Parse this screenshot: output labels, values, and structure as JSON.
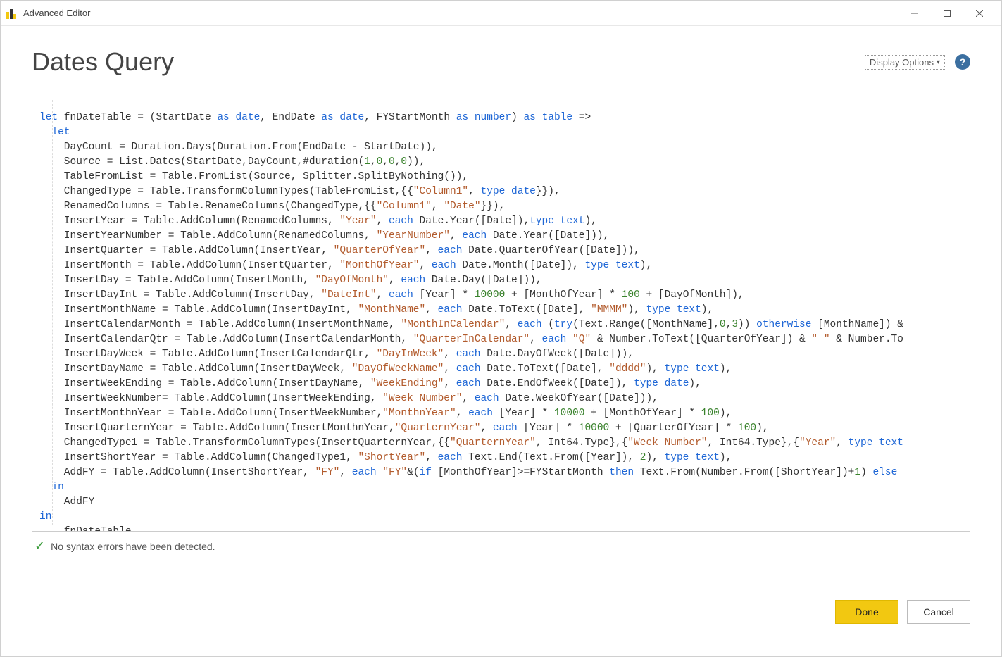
{
  "window": {
    "title": "Advanced Editor"
  },
  "header": {
    "query_title": "Dates Query",
    "display_options_label": "Display Options",
    "help_tooltip": "Help"
  },
  "code": {
    "tokens": [
      [
        [
          "kw",
          "let"
        ],
        [
          "",
          " fnDateTable = (StartDate "
        ],
        [
          "kw",
          "as"
        ],
        [
          "",
          " "
        ],
        [
          "tp",
          "date"
        ],
        [
          "",
          ", EndDate "
        ],
        [
          "kw",
          "as"
        ],
        [
          "",
          " "
        ],
        [
          "tp",
          "date"
        ],
        [
          "",
          ", FYStartMonth "
        ],
        [
          "kw",
          "as"
        ],
        [
          "",
          " "
        ],
        [
          "tp",
          "number"
        ],
        [
          "",
          ") "
        ],
        [
          "kw",
          "as"
        ],
        [
          "",
          " "
        ],
        [
          "tp",
          "table"
        ],
        [
          "",
          " =>"
        ]
      ],
      [
        [
          "",
          "  "
        ],
        [
          "kw",
          "let"
        ]
      ],
      [
        [
          "",
          "    DayCount = Duration.Days(Duration.From(EndDate - StartDate)),"
        ]
      ],
      [
        [
          "",
          "    Source = List.Dates(StartDate,DayCount,#duration("
        ],
        [
          "num",
          "1"
        ],
        [
          "",
          ","
        ],
        [
          "num",
          "0"
        ],
        [
          "",
          ","
        ],
        [
          "num",
          "0"
        ],
        [
          "",
          ","
        ],
        [
          "num",
          "0"
        ],
        [
          "",
          ")),"
        ]
      ],
      [
        [
          "",
          "    TableFromList = Table.FromList(Source, Splitter.SplitByNothing()),"
        ]
      ],
      [
        [
          "",
          "    ChangedType = Table.TransformColumnTypes(TableFromList,{{"
        ],
        [
          "str",
          "\"Column1\""
        ],
        [
          "",
          ", "
        ],
        [
          "kw",
          "type"
        ],
        [
          "",
          " "
        ],
        [
          "tp",
          "date"
        ],
        [
          "",
          "}}),"
        ]
      ],
      [
        [
          "",
          "    RenamedColumns = Table.RenameColumns(ChangedType,{{"
        ],
        [
          "str",
          "\"Column1\""
        ],
        [
          "",
          ", "
        ],
        [
          "str",
          "\"Date\""
        ],
        [
          "",
          "}}),"
        ]
      ],
      [
        [
          "",
          "    InsertYear = Table.AddColumn(RenamedColumns, "
        ],
        [
          "str",
          "\"Year\""
        ],
        [
          "",
          ", "
        ],
        [
          "kw",
          "each"
        ],
        [
          "",
          " Date.Year([Date]),"
        ],
        [
          "kw",
          "type"
        ],
        [
          "",
          " "
        ],
        [
          "tp",
          "text"
        ],
        [
          "",
          "),"
        ]
      ],
      [
        [
          "",
          "    InsertYearNumber = Table.AddColumn(RenamedColumns, "
        ],
        [
          "str",
          "\"YearNumber\""
        ],
        [
          "",
          ", "
        ],
        [
          "kw",
          "each"
        ],
        [
          "",
          " Date.Year([Date])),"
        ]
      ],
      [
        [
          "",
          "    InsertQuarter = Table.AddColumn(InsertYear, "
        ],
        [
          "str",
          "\"QuarterOfYear\""
        ],
        [
          "",
          ", "
        ],
        [
          "kw",
          "each"
        ],
        [
          "",
          " Date.QuarterOfYear([Date])),"
        ]
      ],
      [
        [
          "",
          "    InsertMonth = Table.AddColumn(InsertQuarter, "
        ],
        [
          "str",
          "\"MonthOfYear\""
        ],
        [
          "",
          ", "
        ],
        [
          "kw",
          "each"
        ],
        [
          "",
          " Date.Month([Date]), "
        ],
        [
          "kw",
          "type"
        ],
        [
          "",
          " "
        ],
        [
          "tp",
          "text"
        ],
        [
          "",
          "),"
        ]
      ],
      [
        [
          "",
          "    InsertDay = Table.AddColumn(InsertMonth, "
        ],
        [
          "str",
          "\"DayOfMonth\""
        ],
        [
          "",
          ", "
        ],
        [
          "kw",
          "each"
        ],
        [
          "",
          " Date.Day([Date])),"
        ]
      ],
      [
        [
          "",
          "    InsertDayInt = Table.AddColumn(InsertDay, "
        ],
        [
          "str",
          "\"DateInt\""
        ],
        [
          "",
          ", "
        ],
        [
          "kw",
          "each"
        ],
        [
          "",
          " [Year] * "
        ],
        [
          "num",
          "10000"
        ],
        [
          "",
          " + [MonthOfYear] * "
        ],
        [
          "num",
          "100"
        ],
        [
          "",
          " + [DayOfMonth]),"
        ]
      ],
      [
        [
          "",
          "    InsertMonthName = Table.AddColumn(InsertDayInt, "
        ],
        [
          "str",
          "\"MonthName\""
        ],
        [
          "",
          ", "
        ],
        [
          "kw",
          "each"
        ],
        [
          "",
          " Date.ToText([Date], "
        ],
        [
          "str",
          "\"MMMM\""
        ],
        [
          "",
          "), "
        ],
        [
          "kw",
          "type"
        ],
        [
          "",
          " "
        ],
        [
          "tp",
          "text"
        ],
        [
          "",
          "),"
        ]
      ],
      [
        [
          "",
          "    InsertCalendarMonth = Table.AddColumn(InsertMonthName, "
        ],
        [
          "str",
          "\"MonthInCalendar\""
        ],
        [
          "",
          ", "
        ],
        [
          "kw",
          "each"
        ],
        [
          "",
          " ("
        ],
        [
          "kw",
          "try"
        ],
        [
          "",
          "(Text.Range([MonthName],"
        ],
        [
          "num",
          "0"
        ],
        [
          "",
          ","
        ],
        [
          "num",
          "3"
        ],
        [
          "",
          ")) "
        ],
        [
          "kw",
          "otherwise"
        ],
        [
          "",
          " [MonthName]) &"
        ]
      ],
      [
        [
          "",
          "    InsertCalendarQtr = Table.AddColumn(InsertCalendarMonth, "
        ],
        [
          "str",
          "\"QuarterInCalendar\""
        ],
        [
          "",
          ", "
        ],
        [
          "kw",
          "each"
        ],
        [
          "",
          " "
        ],
        [
          "str",
          "\"Q\""
        ],
        [
          "",
          " & Number.ToText([QuarterOfYear]) & "
        ],
        [
          "str",
          "\" \""
        ],
        [
          "",
          " & Number.To"
        ]
      ],
      [
        [
          "",
          "    InsertDayWeek = Table.AddColumn(InsertCalendarQtr, "
        ],
        [
          "str",
          "\"DayInWeek\""
        ],
        [
          "",
          ", "
        ],
        [
          "kw",
          "each"
        ],
        [
          "",
          " Date.DayOfWeek([Date])),"
        ]
      ],
      [
        [
          "",
          "    InsertDayName = Table.AddColumn(InsertDayWeek, "
        ],
        [
          "str",
          "\"DayOfWeekName\""
        ],
        [
          "",
          ", "
        ],
        [
          "kw",
          "each"
        ],
        [
          "",
          " Date.ToText([Date], "
        ],
        [
          "str",
          "\"dddd\""
        ],
        [
          "",
          "), "
        ],
        [
          "kw",
          "type"
        ],
        [
          "",
          " "
        ],
        [
          "tp",
          "text"
        ],
        [
          "",
          "),"
        ]
      ],
      [
        [
          "",
          "    InsertWeekEnding = Table.AddColumn(InsertDayName, "
        ],
        [
          "str",
          "\"WeekEnding\""
        ],
        [
          "",
          ", "
        ],
        [
          "kw",
          "each"
        ],
        [
          "",
          " Date.EndOfWeek([Date]), "
        ],
        [
          "kw",
          "type"
        ],
        [
          "",
          " "
        ],
        [
          "tp",
          "date"
        ],
        [
          "",
          "),"
        ]
      ],
      [
        [
          "",
          "    InsertWeekNumber= Table.AddColumn(InsertWeekEnding, "
        ],
        [
          "str",
          "\"Week Number\""
        ],
        [
          "",
          ", "
        ],
        [
          "kw",
          "each"
        ],
        [
          "",
          " Date.WeekOfYear([Date])),"
        ]
      ],
      [
        [
          "",
          "    InsertMonthnYear = Table.AddColumn(InsertWeekNumber,"
        ],
        [
          "str",
          "\"MonthnYear\""
        ],
        [
          "",
          ", "
        ],
        [
          "kw",
          "each"
        ],
        [
          "",
          " [Year] * "
        ],
        [
          "num",
          "10000"
        ],
        [
          "",
          " + [MonthOfYear] * "
        ],
        [
          "num",
          "100"
        ],
        [
          "",
          "),"
        ]
      ],
      [
        [
          "",
          "    InsertQuarternYear = Table.AddColumn(InsertMonthnYear,"
        ],
        [
          "str",
          "\"QuarternYear\""
        ],
        [
          "",
          ", "
        ],
        [
          "kw",
          "each"
        ],
        [
          "",
          " [Year] * "
        ],
        [
          "num",
          "10000"
        ],
        [
          "",
          " + [QuarterOfYear] * "
        ],
        [
          "num",
          "100"
        ],
        [
          "",
          "),"
        ]
      ],
      [
        [
          "",
          "    ChangedType1 = Table.TransformColumnTypes(InsertQuarternYear,{{"
        ],
        [
          "str",
          "\"QuarternYear\""
        ],
        [
          "",
          ", Int64.Type},{"
        ],
        [
          "str",
          "\"Week Number\""
        ],
        [
          "",
          ", Int64.Type},{"
        ],
        [
          "str",
          "\"Year\""
        ],
        [
          "",
          ", "
        ],
        [
          "kw",
          "type"
        ],
        [
          "",
          " "
        ],
        [
          "tp",
          "text"
        ]
      ],
      [
        [
          "",
          "    InsertShortYear = Table.AddColumn(ChangedType1, "
        ],
        [
          "str",
          "\"ShortYear\""
        ],
        [
          "",
          ", "
        ],
        [
          "kw",
          "each"
        ],
        [
          "",
          " Text.End(Text.From([Year]), "
        ],
        [
          "num",
          "2"
        ],
        [
          "",
          "), "
        ],
        [
          "kw",
          "type"
        ],
        [
          "",
          " "
        ],
        [
          "tp",
          "text"
        ],
        [
          "",
          "),"
        ]
      ],
      [
        [
          "",
          "    AddFY = Table.AddColumn(InsertShortYear, "
        ],
        [
          "str",
          "\"FY\""
        ],
        [
          "",
          ", "
        ],
        [
          "kw",
          "each"
        ],
        [
          "",
          " "
        ],
        [
          "str",
          "\"FY\""
        ],
        [
          "",
          "&("
        ],
        [
          "kw",
          "if"
        ],
        [
          "",
          " [MonthOfYear]>=FYStartMonth "
        ],
        [
          "kw",
          "then"
        ],
        [
          "",
          " Text.From(Number.From([ShortYear])+"
        ],
        [
          "num",
          "1"
        ],
        [
          "",
          ") "
        ],
        [
          "kw",
          "else"
        ]
      ],
      [
        [
          "",
          "  "
        ],
        [
          "kw",
          "in"
        ]
      ],
      [
        [
          "",
          "    AddFY"
        ]
      ],
      [
        [
          "kw",
          "in"
        ]
      ],
      [
        [
          "",
          "    fnDateTable"
        ]
      ]
    ]
  },
  "status": {
    "message": "No syntax errors have been detected."
  },
  "footer": {
    "done_label": "Done",
    "cancel_label": "Cancel"
  }
}
